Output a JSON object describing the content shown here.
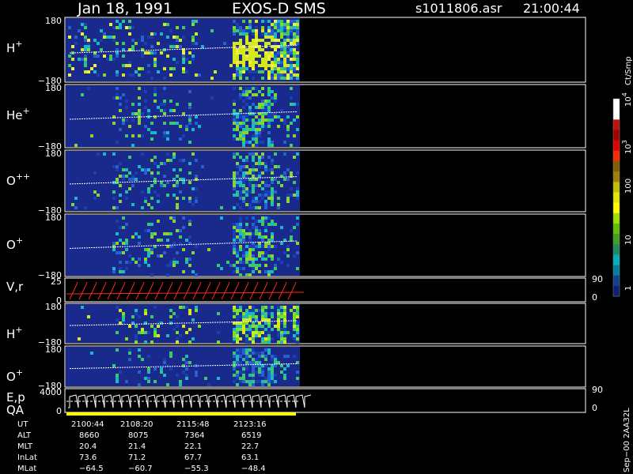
{
  "header": {
    "date": "Jan 18, 1991",
    "instrument": "EXOS-D SMS",
    "file": "s1011806.asr",
    "time": "21:00:44"
  },
  "colors": {
    "background": "#000000",
    "panel": "#1a2a8c",
    "trace": "#ffffff",
    "velocity": "#ff2a1a",
    "qa_bar": "#ffff00"
  },
  "chart_data": {
    "type": "heatmap",
    "panels": [
      {
        "label": "H",
        "sup": "+",
        "ytop": "180",
        "ybot": "−180",
        "ylim": [
          -180,
          180
        ]
      },
      {
        "label": "He",
        "sup": "+",
        "ytop": "180",
        "ybot": "−180",
        "ylim": [
          -180,
          180
        ]
      },
      {
        "label": "O",
        "sup": "++",
        "ytop": "180",
        "ybot": "−180",
        "ylim": [
          -180,
          180
        ]
      },
      {
        "label": "O",
        "sup": "+",
        "ytop": "180",
        "ybot": "−180",
        "ylim": [
          -180,
          180
        ]
      },
      {
        "label": "V,r",
        "sup": "",
        "ytop": "25",
        "ybot": "0",
        "right_top": "90",
        "right_bot": "0"
      },
      {
        "label": "H",
        "sup": "+",
        "ytop": "180",
        "ybot": "−180",
        "ylim": [
          -180,
          180
        ]
      },
      {
        "label": "O",
        "sup": "+",
        "ytop": "180",
        "ybot": "−180",
        "ylim": [
          -180,
          180
        ]
      },
      {
        "label": "E,p",
        "sup": "",
        "ytop": "4000",
        "ybot": "0",
        "right_top": "90",
        "right_bot": "0"
      }
    ],
    "qa_label": "QA",
    "colorbar": {
      "unit": "Ct/Smp",
      "ticks": [
        {
          "text": "10",
          "sup": "4"
        },
        {
          "text": "10",
          "sup": "3"
        },
        {
          "text": "100",
          "sup": ""
        },
        {
          "text": "10",
          "sup": ""
        },
        {
          "text": "1",
          "sup": ""
        }
      ]
    },
    "footer_rows": [
      {
        "name": "UT",
        "values": [
          "2100:44",
          "2108:20",
          "2115:48",
          "2123:16"
        ]
      },
      {
        "name": "ALT",
        "values": [
          "8660",
          "8075",
          "7364",
          "6519"
        ]
      },
      {
        "name": "MLT",
        "values": [
          "20.4",
          "21.4",
          "22.1",
          "22.7"
        ]
      },
      {
        "name": "InLat",
        "values": [
          "73.6",
          "71.2",
          "67.7",
          "63.1"
        ]
      },
      {
        "name": "MLat",
        "values": [
          "−64.5",
          "−60.7",
          "−55.3",
          "−48.4"
        ]
      }
    ],
    "side_label": "Sep−00 2AA32L"
  }
}
